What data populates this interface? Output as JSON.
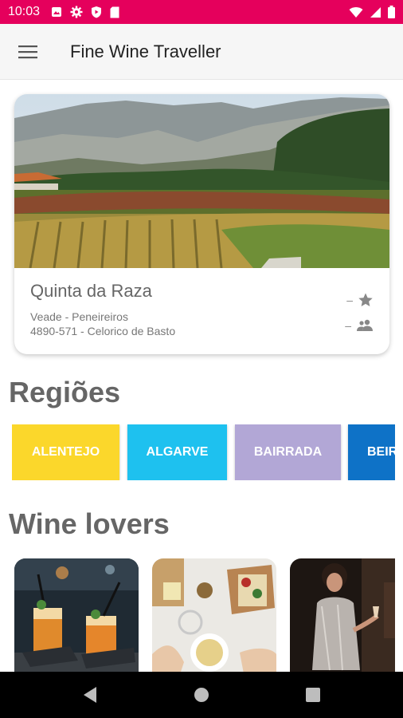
{
  "status_bar": {
    "time": "10:03",
    "left_icons": [
      "photo-icon",
      "gear-icon",
      "shield-icon",
      "sd-card-icon"
    ],
    "right_icons": [
      "wifi-icon",
      "signal-icon",
      "battery-icon"
    ]
  },
  "app_bar": {
    "menu_icon": "menu-icon",
    "title": "Fine Wine Traveller"
  },
  "featured": {
    "name": "Quinta da Raza",
    "address_line1": "Veade - Peneireiros",
    "address_line2": "4890-571 - Celorico de Basto",
    "rating": "–",
    "people": "–",
    "rating_icon": "star-icon",
    "people_icon": "people-icon"
  },
  "regions": {
    "title": "Regiões",
    "items": [
      {
        "label": "ALENTEJO",
        "color": "#fbd72b"
      },
      {
        "label": "ALGARVE",
        "color": "#1ec1ef"
      },
      {
        "label": "BAIRRADA",
        "color": "#b2a7d6"
      },
      {
        "label": "BEIRA",
        "color": "#0e72c7"
      }
    ]
  },
  "wine_lovers": {
    "title": "Wine lovers",
    "items": [
      "cocktails-photo",
      "food-platter-photo",
      "party-photo"
    ]
  },
  "nav_bar": {
    "icons": [
      "back-icon",
      "home-icon",
      "recents-icon"
    ]
  },
  "colors": {
    "status_bar": "#e5005c",
    "app_bar": "#f6f6f6",
    "section_title": "#666666"
  }
}
